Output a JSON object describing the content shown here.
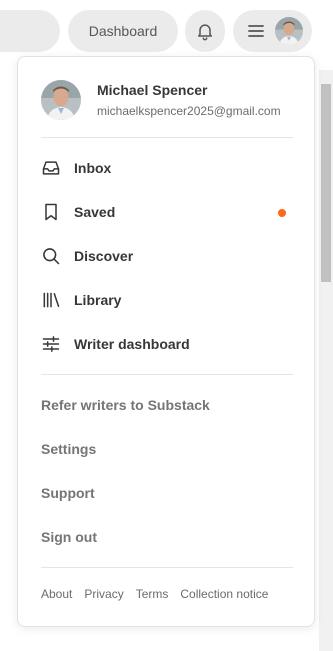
{
  "topbar": {
    "dashboard_label": "Dashboard",
    "bell_icon": "bell-icon",
    "menu_icon": "hamburger-menu-icon"
  },
  "profile": {
    "name": "Michael Spencer",
    "email": "michaelkspencer2025@gmail.com"
  },
  "nav": {
    "inbox": "Inbox",
    "saved": "Saved",
    "discover": "Discover",
    "library": "Library",
    "writer_dashboard": "Writer dashboard"
  },
  "secondary": {
    "refer": "Refer writers to Substack",
    "settings": "Settings",
    "support": "Support",
    "sign_out": "Sign out"
  },
  "footer": {
    "about": "About",
    "privacy": "Privacy",
    "terms": "Terms",
    "collection_notice": "Collection notice"
  },
  "colors": {
    "accent_dot": "#ff6719",
    "pill_bg": "#ebebeb"
  }
}
